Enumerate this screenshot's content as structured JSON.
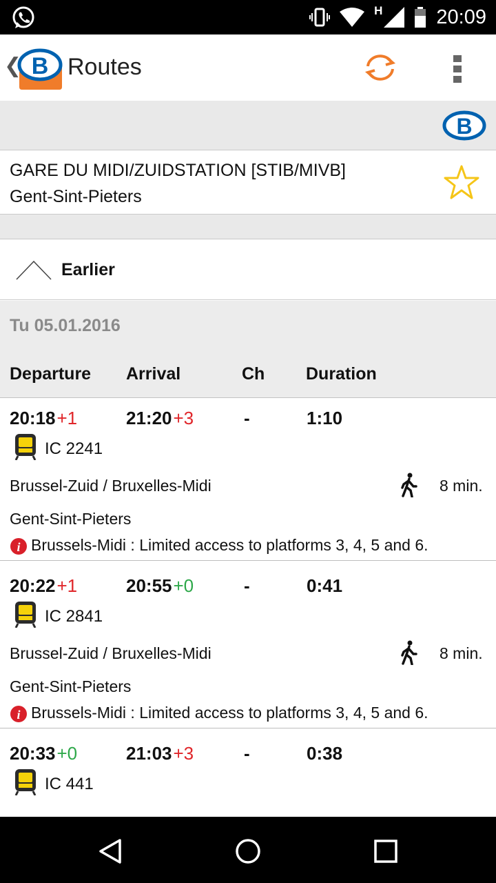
{
  "status_bar": {
    "time": "20:09",
    "network_type": "H"
  },
  "app_bar": {
    "back": "❮",
    "title": "Routes"
  },
  "route": {
    "from": "GARE DU MIDI/ZUIDSTATION [STIB/MIVB]",
    "to": "Gent-Sint-Pieters"
  },
  "earlier_label": "Earlier",
  "date": "Tu 05.01.2016",
  "columns": {
    "departure": "Departure",
    "arrival": "Arrival",
    "changes": "Ch",
    "duration": "Duration"
  },
  "connections": [
    {
      "departure": "20:18",
      "departure_delay": "+1",
      "departure_delay_color": "#e0262a",
      "arrival": "21:20",
      "arrival_delay": "+3",
      "arrival_delay_color": "#e0262a",
      "changes": "-",
      "duration": "1:10",
      "train": "IC 2241",
      "station": "Brussel-Zuid / Bruxelles-Midi",
      "walk": "8 min.",
      "destination": "Gent-Sint-Pieters",
      "notice": "Brussels-Midi : Limited access to platforms 3, 4, 5 and 6."
    },
    {
      "departure": "20:22",
      "departure_delay": "+1",
      "departure_delay_color": "#e0262a",
      "arrival": "20:55",
      "arrival_delay": "+0",
      "arrival_delay_color": "#2ea84a",
      "changes": "-",
      "duration": "0:41",
      "train": "IC 2841",
      "station": "Brussel-Zuid / Bruxelles-Midi",
      "walk": "8 min.",
      "destination": "Gent-Sint-Pieters",
      "notice": "Brussels-Midi : Limited access to platforms 3, 4, 5 and 6."
    },
    {
      "departure": "20:33",
      "departure_delay": "+0",
      "departure_delay_color": "#2ea84a",
      "arrival": "21:03",
      "arrival_delay": "+3",
      "arrival_delay_color": "#e0262a",
      "changes": "-",
      "duration": "0:38",
      "train": "IC 441"
    }
  ],
  "colors": {
    "accent": "#f07c2a",
    "brand_blue": "#0062b0",
    "star": "#f5c518"
  }
}
